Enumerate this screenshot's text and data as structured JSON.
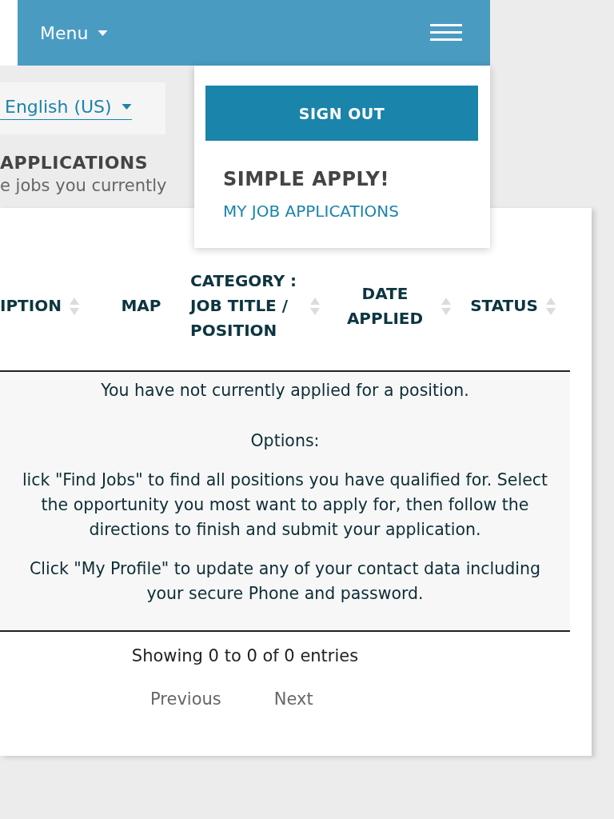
{
  "topbar": {
    "menu_label": "Menu",
    "menu_open": true
  },
  "menu_dropdown": {
    "button": "SIGN OUT",
    "heading": "SIMPLE APPLY!",
    "link": "MY JOB APPLICATIONS"
  },
  "language": {
    "value": "English (US)"
  },
  "page": {
    "title": "APPLICATIONS",
    "subtitle": "e jobs you currently"
  },
  "table": {
    "columns": [
      {
        "label": "IPTION",
        "sortable": true
      },
      {
        "label": "MAP",
        "sortable": false
      },
      {
        "label": "CATEGORY : JOB TITLE / POSITION",
        "sortable": true
      },
      {
        "label": "DATE APPLIED",
        "sortable": true
      },
      {
        "label": "STATUS",
        "sortable": true
      }
    ],
    "empty_message": [
      "You have not currently applied for a position.",
      "Options:",
      "lick \"Find Jobs\" to find all positions you have qualified for.  Select the opportunity you most want to apply for, then follow the directions to finish and submit your application.",
      "Click \"My Profile\" to update any of your contact data including your secure Phone and password."
    ],
    "info": "Showing 0 to 0 of 0 entries",
    "pagination": [
      "Previous",
      "Next"
    ]
  }
}
